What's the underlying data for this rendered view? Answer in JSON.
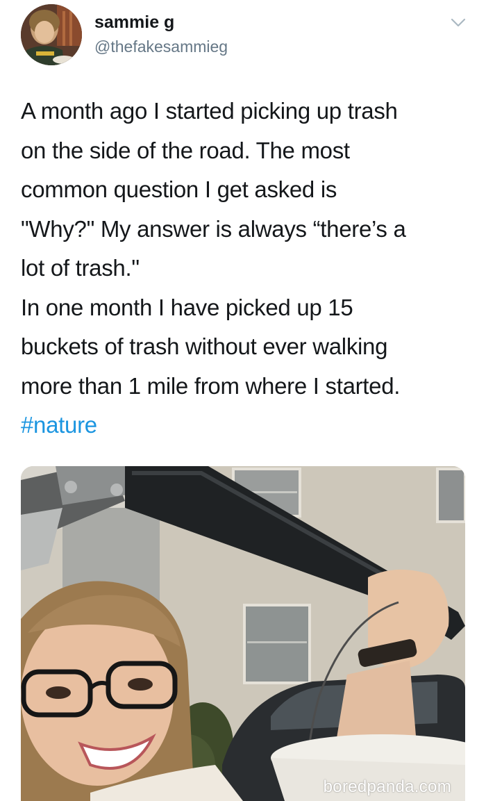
{
  "tweet": {
    "author": {
      "display_name": "sammie g",
      "handle": "@thefakesammieg",
      "avatar_icon": "avatar-photo"
    },
    "menu_icon": "chevron-down-icon",
    "text_lines": [
      "A month ago I started picking up trash",
      "on the side of the road. The most",
      "common question I get asked is",
      "\"Why?\" My answer is always “there’s a",
      "lot of trash.\"",
      "In one month I have picked up 15",
      "buckets of trash without ever walking",
      "more than 1 mile from where I started."
    ],
    "hashtag": "#nature",
    "media": {
      "watermark": "boredpanda.com"
    }
  },
  "colors": {
    "text": "#14171a",
    "secondary": "#657786",
    "link": "#1b95e0"
  }
}
